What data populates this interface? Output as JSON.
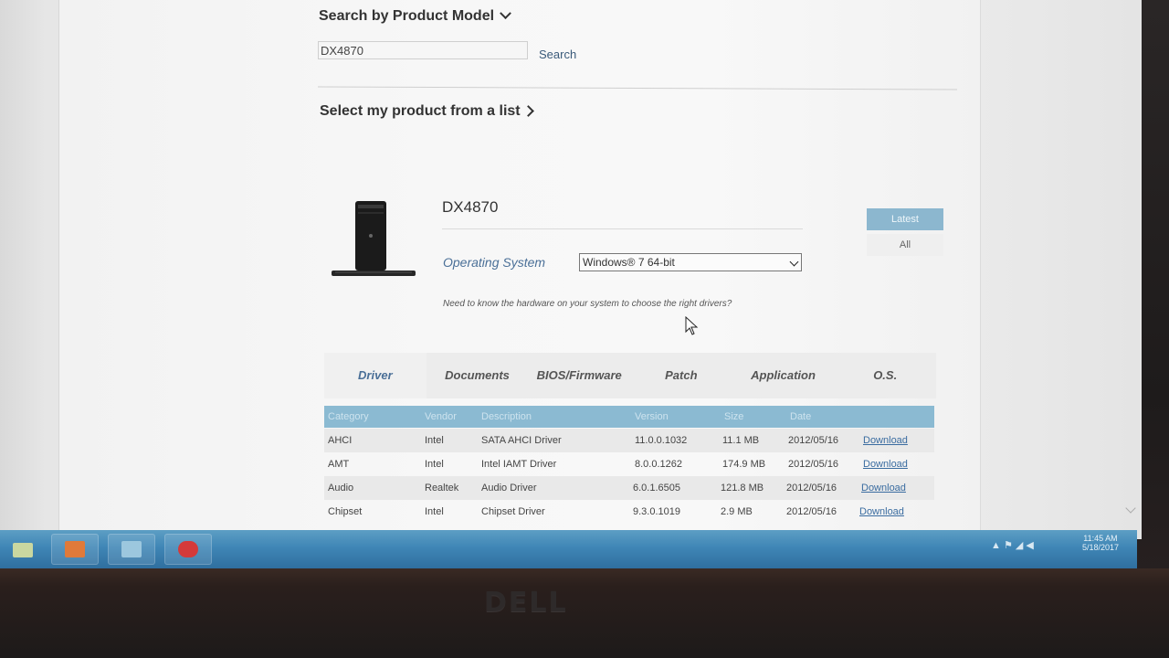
{
  "search_model": {
    "title": "Search by Product Model",
    "input_value": "DX4870",
    "button_label": "Search"
  },
  "product_list": {
    "title": "Select my product from a list"
  },
  "product": {
    "name": "DX4870",
    "os_label": "Operating System",
    "os_value": "Windows® 7 64-bit",
    "hint": "Need to know the hardware on your system to choose the right drivers?"
  },
  "view_toggle": {
    "latest": "Latest",
    "all": "All"
  },
  "tabs": [
    {
      "label": "Driver",
      "active": true
    },
    {
      "label": "Documents",
      "active": false
    },
    {
      "label": "BIOS/Firmware",
      "active": false
    },
    {
      "label": "Patch",
      "active": false
    },
    {
      "label": "Application",
      "active": false
    },
    {
      "label": "O.S.",
      "active": false
    }
  ],
  "table": {
    "headers": [
      "Category",
      "Vendor",
      "Description",
      "Version",
      "Size",
      "Date"
    ],
    "rows": [
      {
        "category": "AHCI",
        "vendor": "Intel",
        "description": "SATA AHCI Driver",
        "version": "11.0.0.1032",
        "size": "11.1 MB",
        "date": "2012/05/16",
        "action": "Download"
      },
      {
        "category": "AMT",
        "vendor": "Intel",
        "description": "Intel IAMT Driver",
        "version": "8.0.0.1262",
        "size": "174.9 MB",
        "date": "2012/05/16",
        "action": "Download"
      },
      {
        "category": "Audio",
        "vendor": "Realtek",
        "description": "Audio Driver",
        "version": "6.0.1.6505",
        "size": "121.8 MB",
        "date": "2012/05/16",
        "action": "Download"
      },
      {
        "category": "Chipset",
        "vendor": "Intel",
        "description": "Chipset Driver",
        "version": "9.3.0.1019",
        "size": "2.9 MB",
        "date": "2012/05/16",
        "action": "Download"
      }
    ]
  },
  "taskbar": {
    "time": "11:45 AM",
    "date": "5/18/2017"
  },
  "monitor": {
    "brand": "DELL"
  },
  "colors": {
    "accent_blue": "#4a6f97",
    "table_header": "#8bbad2",
    "taskbar": "#3f86b6"
  }
}
